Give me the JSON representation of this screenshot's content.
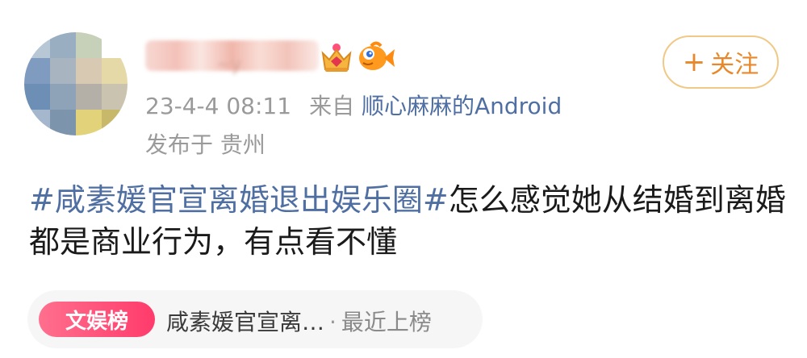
{
  "post": {
    "timestamp": "23-4-4 08:11",
    "source_prefix": "来自",
    "source_device": "顺心麻麻的Android",
    "location": "发布于 贵州",
    "topic": "#咸素媛官宣离婚退出娱乐圈#",
    "body": "怎么感觉她从结婚到离婚都是商业行为，有点看不懂"
  },
  "follow_button": {
    "icon": "+",
    "label": "关注"
  },
  "hot_chip": {
    "badge": "文娱榜",
    "title": "咸素媛官宣离…",
    "separator": "·",
    "rank_text": "最近上榜"
  },
  "icons": [
    "crown-icon",
    "fish-icon",
    "plus-icon"
  ],
  "colors": {
    "link_blue": "#4f6fa3",
    "follow_orange": "#e8882a",
    "follow_border": "#f0c987",
    "badge_pink": "#ff3b6c",
    "meta_gray": "#9a9a9a"
  }
}
